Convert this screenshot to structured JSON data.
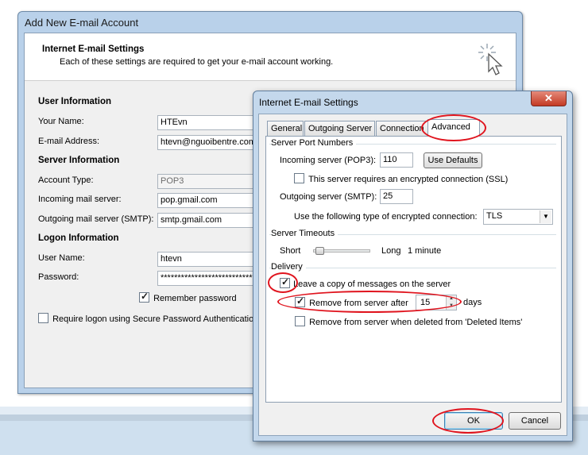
{
  "main_window": {
    "title": "Add New E-mail Account",
    "header_title": "Internet E-mail Settings",
    "header_subtitle": "Each of these settings are required to get your e-mail account working.",
    "user_info": {
      "heading": "User Information",
      "name_label": "Your Name:",
      "name_value": "HTEvn",
      "email_label": "E-mail Address:",
      "email_value": "htevn@nguoibentre.com"
    },
    "server_info": {
      "heading": "Server Information",
      "account_type_label": "Account Type:",
      "account_type_value": "POP3",
      "incoming_label": "Incoming mail server:",
      "incoming_value": "pop.gmail.com",
      "outgoing_label": "Outgoing mail server (SMTP):",
      "outgoing_value": "smtp.gmail.com"
    },
    "logon_info": {
      "heading": "Logon Information",
      "username_label": "User Name:",
      "username_value": "htevn",
      "password_label": "Password:",
      "password_value": "*****************************",
      "remember_label": "Remember password",
      "remember_checked": true,
      "spa_label": "Require logon using Secure Password Authentication",
      "spa_checked": false
    }
  },
  "dialog": {
    "title": "Internet E-mail Settings",
    "close_icon": "close-icon",
    "tabs": [
      "General",
      "Outgoing Server",
      "Connection",
      "Advanced"
    ],
    "active_tab": "Advanced",
    "server_ports": {
      "heading": "Server Port Numbers",
      "incoming_label": "Incoming server (POP3):",
      "incoming_value": "110",
      "use_defaults": "Use Defaults",
      "ssl_label": "This server requires an encrypted connection (SSL)",
      "ssl_checked": false,
      "outgoing_label": "Outgoing server (SMTP):",
      "outgoing_value": "25",
      "encryption_label": "Use the following type of encrypted connection:",
      "encryption_value": "TLS"
    },
    "timeouts": {
      "heading": "Server Timeouts",
      "short_label": "Short",
      "long_label": "Long",
      "value": "1 minute",
      "slider_level": 0.05
    },
    "delivery": {
      "heading": "Delivery",
      "leave_copy_label": "Leave a copy of messages on the server",
      "leave_copy_checked": true,
      "remove_after_label": "Remove from server after",
      "remove_after_checked": true,
      "remove_after_days": "15",
      "days_label": "days",
      "remove_deleted_label": "Remove from server when deleted from 'Deleted Items'",
      "remove_deleted_checked": false
    },
    "ok_label": "OK",
    "cancel_label": "Cancel"
  },
  "colors": {
    "highlight_ellipse": "#e0141e",
    "window_frame": "#b9d1ea"
  }
}
